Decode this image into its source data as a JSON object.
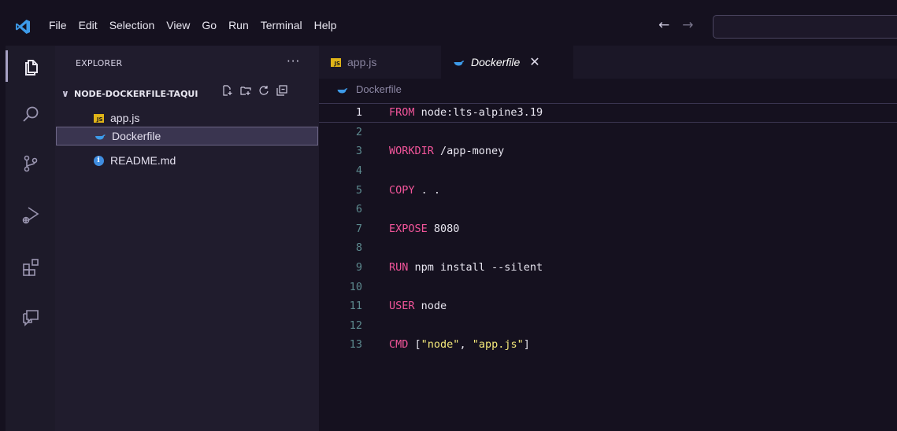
{
  "menu": [
    "File",
    "Edit",
    "Selection",
    "View",
    "Go",
    "Run",
    "Terminal",
    "Help"
  ],
  "explorer": {
    "title": "EXPLORER",
    "more": "···",
    "folder": "NODE-DOCKERFILE-TAQUI",
    "files": [
      {
        "name": "app.js",
        "icon": "js-file-icon"
      },
      {
        "name": "Dockerfile",
        "icon": "docker-icon"
      },
      {
        "name": "README.md",
        "icon": "info-icon"
      }
    ]
  },
  "tabs": [
    {
      "label": "app.js",
      "active": false
    },
    {
      "label": "Dockerfile",
      "active": true
    }
  ],
  "breadcrumb": "Dockerfile",
  "code": [
    {
      "n": "1",
      "kw": "FROM",
      "rest": " node:lts-alpine3.19"
    },
    {
      "n": "2",
      "kw": "",
      "rest": ""
    },
    {
      "n": "3",
      "kw": "WORKDIR",
      "rest": " /app-money"
    },
    {
      "n": "4",
      "kw": "",
      "rest": ""
    },
    {
      "n": "5",
      "kw": "COPY",
      "rest": " . ."
    },
    {
      "n": "6",
      "kw": "",
      "rest": ""
    },
    {
      "n": "7",
      "kw": "EXPOSE",
      "rest": " 8080"
    },
    {
      "n": "8",
      "kw": "",
      "rest": ""
    },
    {
      "n": "9",
      "kw": "RUN",
      "rest": " npm install --silent"
    },
    {
      "n": "10",
      "kw": "",
      "rest": ""
    },
    {
      "n": "11",
      "kw": "USER",
      "rest": " node"
    },
    {
      "n": "12",
      "kw": "",
      "rest": ""
    },
    {
      "n": "13",
      "kw": "CMD",
      "rest": " [",
      "s1": "\"node\"",
      "mid": ", ",
      "s2": "\"app.js\"",
      "end": "]"
    }
  ],
  "colors": {
    "accent": "#f2559a",
    "string": "#f5e97a",
    "background": "#15111f"
  }
}
